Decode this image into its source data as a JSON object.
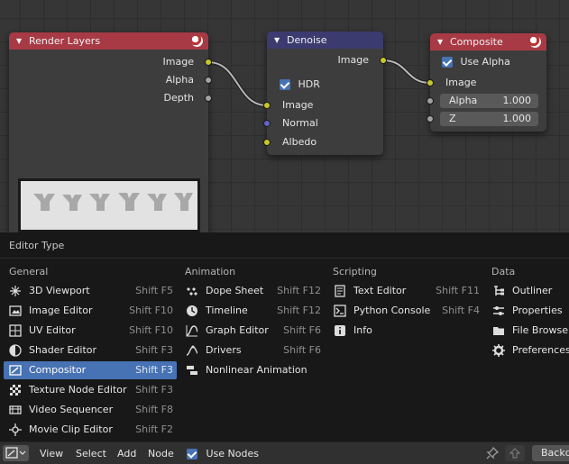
{
  "nodes": {
    "render_layers": {
      "title": "Render Layers",
      "color": "#a83a45",
      "outputs": [
        "Image",
        "Alpha",
        "Depth"
      ]
    },
    "denoise": {
      "title": "Denoise",
      "color": "#3b3b70",
      "output": "Image",
      "hdr_label": "HDR",
      "inputs": [
        "Image",
        "Normal",
        "Albedo"
      ]
    },
    "composite": {
      "title": "Composite",
      "color": "#a83a45",
      "use_alpha_label": "Use Alpha",
      "input": "Image",
      "alpha_label": "Alpha",
      "alpha_value": "1.000",
      "z_label": "Z",
      "z_value": "1.000"
    }
  },
  "popup": {
    "title": "Editor Type",
    "columns": {
      "general": {
        "heading": "General",
        "items": [
          {
            "label": "3D Viewport",
            "shortcut": "Shift F5",
            "icon": "3d-viewport-icon"
          },
          {
            "label": "Image Editor",
            "shortcut": "Shift F10",
            "icon": "image-editor-icon"
          },
          {
            "label": "UV Editor",
            "shortcut": "Shift F10",
            "icon": "uv-editor-icon"
          },
          {
            "label": "Shader Editor",
            "shortcut": "Shift F3",
            "icon": "shader-editor-icon"
          },
          {
            "label": "Compositor",
            "shortcut": "Shift F3",
            "icon": "compositor-icon",
            "active": true
          },
          {
            "label": "Texture Node Editor",
            "shortcut": "Shift F3",
            "icon": "texture-node-editor-icon"
          },
          {
            "label": "Video Sequencer",
            "shortcut": "Shift F8",
            "icon": "video-sequencer-icon"
          },
          {
            "label": "Movie Clip Editor",
            "shortcut": "Shift F2",
            "icon": "movie-clip-editor-icon"
          }
        ]
      },
      "animation": {
        "heading": "Animation",
        "items": [
          {
            "label": "Dope Sheet",
            "shortcut": "Shift F12",
            "icon": "dope-sheet-icon"
          },
          {
            "label": "Timeline",
            "shortcut": "Shift F12",
            "icon": "timeline-icon"
          },
          {
            "label": "Graph Editor",
            "shortcut": "Shift F6",
            "icon": "graph-editor-icon"
          },
          {
            "label": "Drivers",
            "shortcut": "Shift F6",
            "icon": "drivers-icon"
          },
          {
            "label": "Nonlinear Animation",
            "shortcut": "",
            "icon": "nonlinear-animation-icon"
          }
        ]
      },
      "scripting": {
        "heading": "Scripting",
        "items": [
          {
            "label": "Text Editor",
            "shortcut": "Shift F11",
            "icon": "text-editor-icon"
          },
          {
            "label": "Python Console",
            "shortcut": "Shift F4",
            "icon": "python-console-icon"
          },
          {
            "label": "Info",
            "shortcut": "",
            "icon": "info-icon"
          }
        ]
      },
      "data": {
        "heading": "Data",
        "items": [
          {
            "label": "Outliner",
            "shortcut": "",
            "icon": "outliner-icon"
          },
          {
            "label": "Properties",
            "shortcut": "",
            "icon": "properties-icon"
          },
          {
            "label": "File Browser",
            "shortcut": "",
            "icon": "file-browser-icon"
          },
          {
            "label": "Preferences",
            "shortcut": "",
            "icon": "preferences-icon"
          }
        ]
      }
    }
  },
  "header": {
    "menus": [
      "View",
      "Select",
      "Add",
      "Node"
    ],
    "use_nodes_label": "Use Nodes",
    "backdrop_label": "Backd"
  },
  "colors": {
    "accent": "#4772b3",
    "socket_yellow": "#c7c729",
    "socket_grey": "#a1a1a1",
    "socket_blue": "#6363c7"
  }
}
